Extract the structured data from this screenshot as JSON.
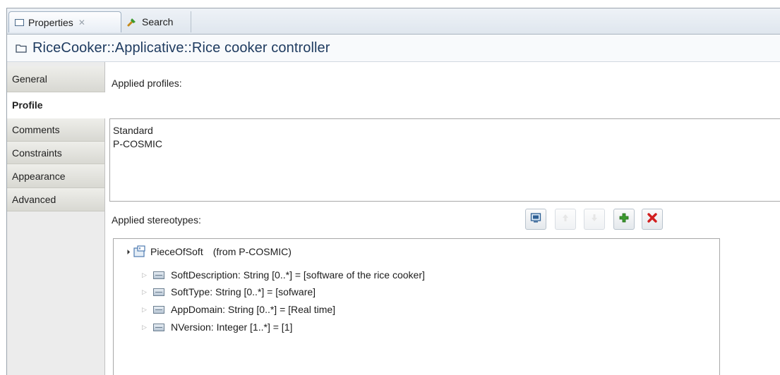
{
  "tabs": [
    {
      "label": "Properties",
      "active": true,
      "icon": "properties-icon"
    },
    {
      "label": "Search",
      "active": false,
      "icon": "search-icon"
    }
  ],
  "title": "RiceCooker::Applicative::Rice cooker controller",
  "side_tabs": [
    {
      "label": "General",
      "selected": false
    },
    {
      "label": "Profile",
      "selected": true
    },
    {
      "label": "Comments",
      "selected": false
    },
    {
      "label": "Constraints",
      "selected": false
    },
    {
      "label": "Appearance",
      "selected": false
    },
    {
      "label": "Advanced",
      "selected": false
    }
  ],
  "profile": {
    "applied_profiles_label": "Applied profiles:",
    "applied_profiles": [
      "Standard",
      "P-COSMIC"
    ],
    "applied_stereotypes_label": "Applied stereotypes:",
    "toolbar": [
      {
        "name": "display-stereotype",
        "icon": "monitor-icon",
        "enabled": true
      },
      {
        "name": "move-up",
        "icon": "up-icon",
        "enabled": false
      },
      {
        "name": "move-down",
        "icon": "down-icon",
        "enabled": false
      },
      {
        "name": "add-stereotype",
        "icon": "plus-icon",
        "enabled": true
      },
      {
        "name": "remove-stereotype",
        "icon": "delete-icon",
        "enabled": true
      }
    ],
    "stereotype": {
      "name": "PieceOfSoft",
      "from": "(from P-COSMIC)",
      "attributes": [
        "SoftDescription: String [0..*] = [software of the rice cooker]",
        "SoftType: String [0..*] = [sofware]",
        "AppDomain: String [0..*] = [Real time]",
        "NVersion: Integer [1..*] = [1]"
      ]
    }
  },
  "colors": {
    "title_text": "#1d3a5f",
    "add_green": "#3c9a2e",
    "delete_red": "#d21f1f"
  }
}
